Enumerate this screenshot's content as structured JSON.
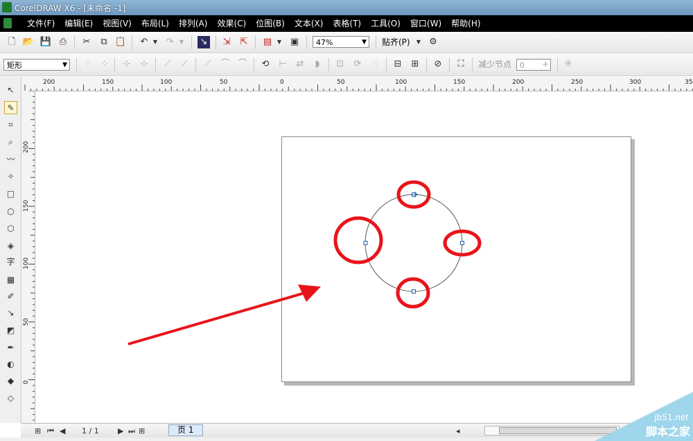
{
  "window": {
    "title": "CorelDRAW X6 - [未命名 -1]"
  },
  "menu": {
    "items": [
      "文件(F)",
      "编辑(E)",
      "视图(V)",
      "布局(L)",
      "排列(A)",
      "效果(C)",
      "位图(B)",
      "文本(X)",
      "表格(T)",
      "工具(O)",
      "窗口(W)",
      "帮助(H)"
    ]
  },
  "standard_toolbar": {
    "zoom_value": "47%",
    "snap_label": "贴齐(P)"
  },
  "property_bar": {
    "shape_select": "矩形",
    "reduce_nodes_label": "减少节点",
    "reduce_nodes_value": "0"
  },
  "rulers": {
    "horizontal_ticks": [
      "200",
      "150",
      "100",
      "50",
      "0",
      "50",
      "100",
      "150",
      "200",
      "250",
      "300",
      "35"
    ],
    "vertical_ticks": [
      "200",
      "150",
      "100",
      "50",
      "0"
    ]
  },
  "toolbox": {
    "tool_glyphs": [
      "↖",
      "✎",
      "⌗",
      "⌕",
      "〰",
      "✧",
      "□",
      "○",
      "⬡",
      "◈",
      "字",
      "▦",
      "✐",
      "↘",
      "◩",
      "✒",
      "◐",
      "◆",
      "◇"
    ]
  },
  "status": {
    "page_count": "1 / 1",
    "page_tab": "页 1"
  },
  "watermark": {
    "site": "jb51.net",
    "name": "脚本之家"
  },
  "colors": {
    "highlight": "#e8141b",
    "node": "#1f5fa8",
    "menu_bg": "#000000"
  }
}
